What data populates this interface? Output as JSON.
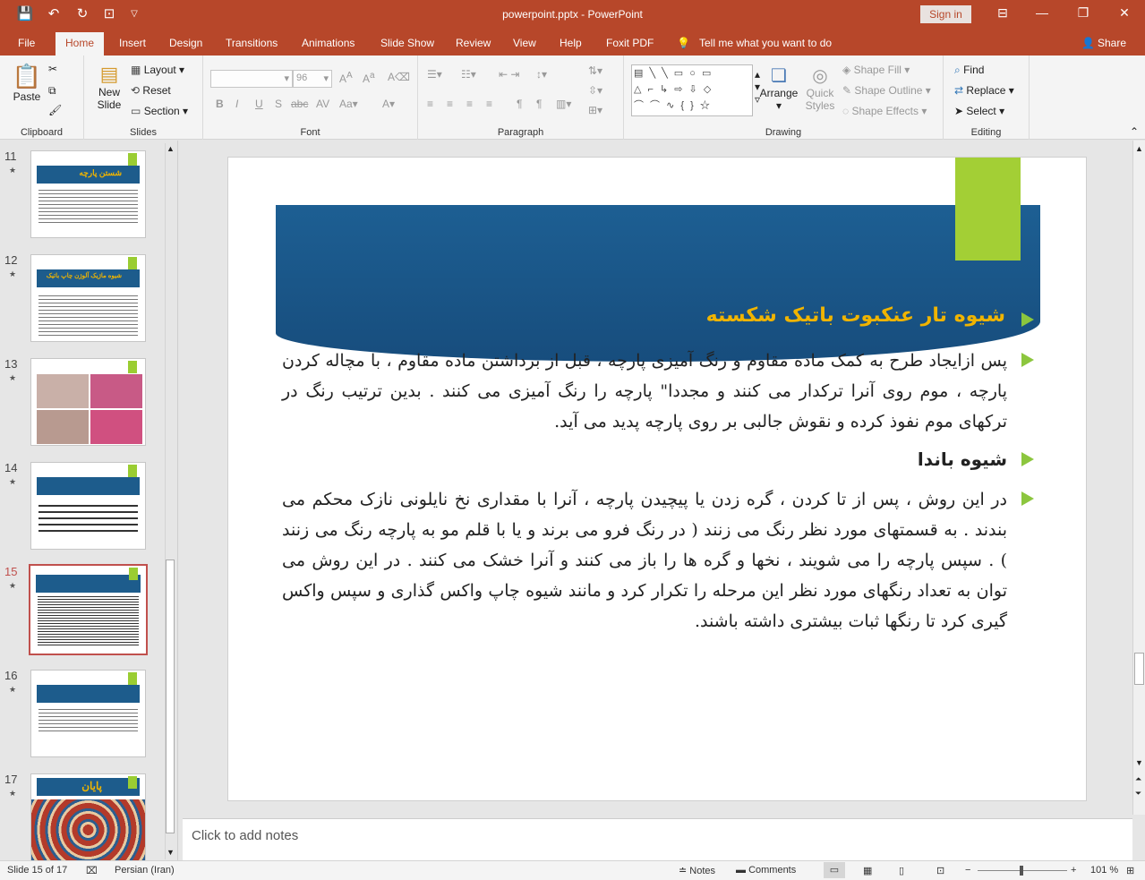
{
  "window": {
    "title": "powerpoint.pptx  -  PowerPoint",
    "sign_in": "Sign in"
  },
  "quick_access": {
    "save_icon": "save-icon",
    "undo_icon": "undo-icon",
    "redo_icon": "redo-icon",
    "present_icon": "present-icon"
  },
  "tabs": [
    "File",
    "Home",
    "Insert",
    "Design",
    "Transitions",
    "Animations",
    "Slide Show",
    "Review",
    "View",
    "Help",
    "Foxit PDF"
  ],
  "tell_me": "Tell me what you want to do",
  "share": "Share",
  "ribbon": {
    "clipboard": {
      "label": "Clipboard",
      "paste": "Paste"
    },
    "slides": {
      "label": "Slides",
      "new_slide_1": "New",
      "new_slide_2": "Slide",
      "layout": "Layout",
      "reset": "Reset",
      "section": "Section"
    },
    "font": {
      "label": "Font",
      "font_size": "96"
    },
    "paragraph": {
      "label": "Paragraph"
    },
    "drawing": {
      "label": "Drawing",
      "arrange": "Arrange",
      "quick_styles_1": "Quick",
      "quick_styles_2": "Styles",
      "shape_fill": "Shape Fill",
      "shape_outline": "Shape Outline",
      "shape_effects": "Shape Effects"
    },
    "editing": {
      "label": "Editing",
      "find": "Find",
      "replace": "Replace",
      "select": "Select"
    }
  },
  "thumbnails": [
    {
      "num": "11",
      "title": "شستن پارچه"
    },
    {
      "num": "12",
      "title": "شیوه ماژیک آلوژن چاپ باتیک"
    },
    {
      "num": "13",
      "title": ""
    },
    {
      "num": "14",
      "title": ""
    },
    {
      "num": "15",
      "title": ""
    },
    {
      "num": "16",
      "title": ""
    },
    {
      "num": "17",
      "title": "پایان"
    }
  ],
  "slide": {
    "title": "شیوه تار عنکبوت باتیک شکسته",
    "para1": "پس ازایجاد طرح به کمک ماده مقاوم و رنگ آمیزی پارچه ، قبل از برداشتن ماده مقاوم ، با مچاله کردن پارچه ، موم روی آنرا ترکدار می کنند و مجددا\" پارچه را رنگ آمیزی می کنند . بدین ترتیب رنگ در ترکهای موم نفوذ کرده و نقوش جالبی بر روی پارچه پدید می آید.",
    "heading2": "شیوه باندا",
    "para2": "در این روش ، پس از تا کردن ، گره زدن یا پیچیدن پارچه ، آنرا با مقداری نخ نایلونی نازک محکم می بندند . به قسمتهای مورد نظر رنگ می زنند ( در رنگ فرو می برند و یا با قلم مو به پارچه رنگ می زنند ) . سپس پارچه را می شویند ، نخها و گره ها را باز می کنند و آنرا خشک می کنند . در این روش می توان به تعداد رنگهای مورد نظر این مرحله را تکرار کرد و مانند شیوه چاپ واکس گذاری و سپس واکس گیری کرد تا رنگها ثبات بیشتری داشته باشند."
  },
  "notes_placeholder": "Click to add notes",
  "status": {
    "slide": "Slide 15 of 17",
    "language": "Persian (Iran)",
    "notes": "Notes",
    "comments": "Comments",
    "zoom": "101 %"
  }
}
